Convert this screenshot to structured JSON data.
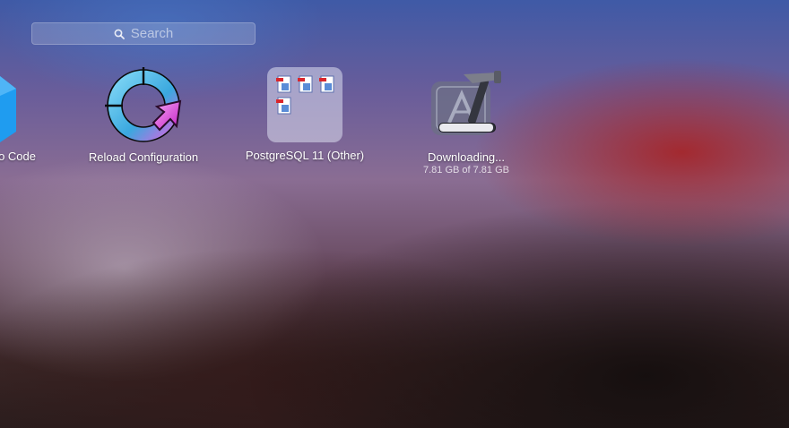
{
  "search": {
    "placeholder": "Search"
  },
  "apps": [
    {
      "label": "o Code"
    },
    {
      "label": "Reload Configuration"
    },
    {
      "label": "PostgreSQL 11 (Other)"
    },
    {
      "label": "Downloading...",
      "sub": "7.81 GB of 7.81 GB",
      "progress": 0.96
    }
  ]
}
